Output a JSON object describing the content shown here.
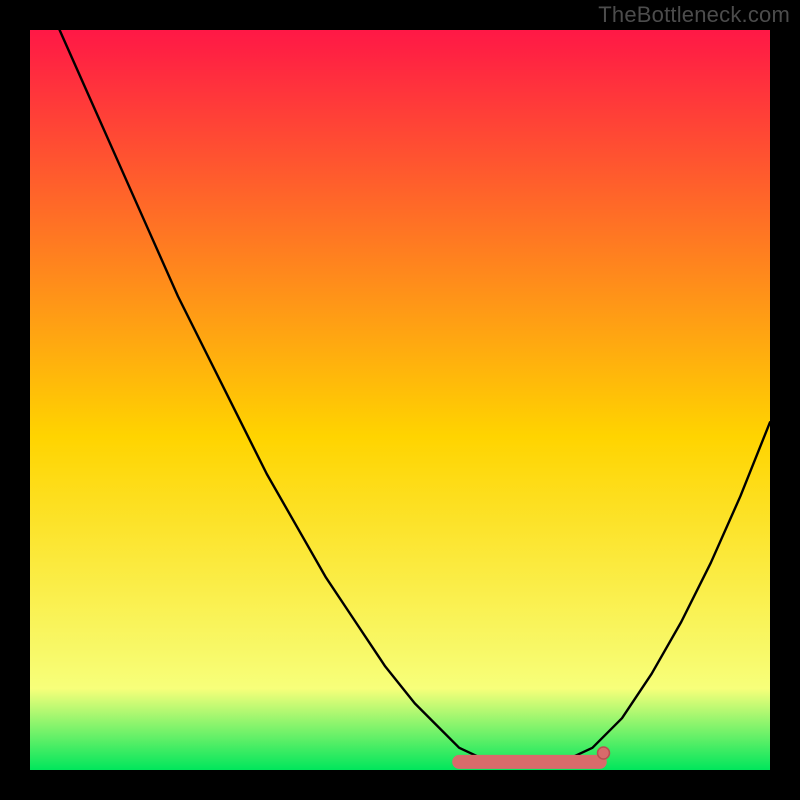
{
  "watermark": "TheBottleneck.com",
  "colors": {
    "background": "#000000",
    "gradient_top": "#ff1846",
    "gradient_mid": "#ffd400",
    "gradient_low": "#f7ff7a",
    "gradient_bottom": "#00e65c",
    "curve": "#000000",
    "marker_fill": "#d86b6b",
    "marker_stroke": "#b84f4f"
  },
  "chart_data": {
    "type": "line",
    "title": "",
    "xlabel": "",
    "ylabel": "",
    "xlim": [
      0,
      100
    ],
    "ylim": [
      0,
      100
    ],
    "series": [
      {
        "name": "bottleneck-curve",
        "x": [
          0,
          4,
          8,
          12,
          16,
          20,
          24,
          28,
          32,
          36,
          40,
          44,
          48,
          52,
          55,
          58,
          61,
          64,
          67,
          70,
          73,
          76,
          80,
          84,
          88,
          92,
          96,
          100
        ],
        "y": [
          110,
          100,
          91,
          82,
          73,
          64,
          56,
          48,
          40,
          33,
          26,
          20,
          14,
          9,
          6,
          3,
          1.6,
          1.1,
          1,
          1.1,
          1.6,
          3,
          7,
          13,
          20,
          28,
          37,
          47
        ]
      }
    ],
    "optimal_band": {
      "x_start": 58,
      "x_end": 77,
      "y": 1.1
    },
    "optimal_dot": {
      "x": 77.5,
      "y": 2.3
    }
  }
}
